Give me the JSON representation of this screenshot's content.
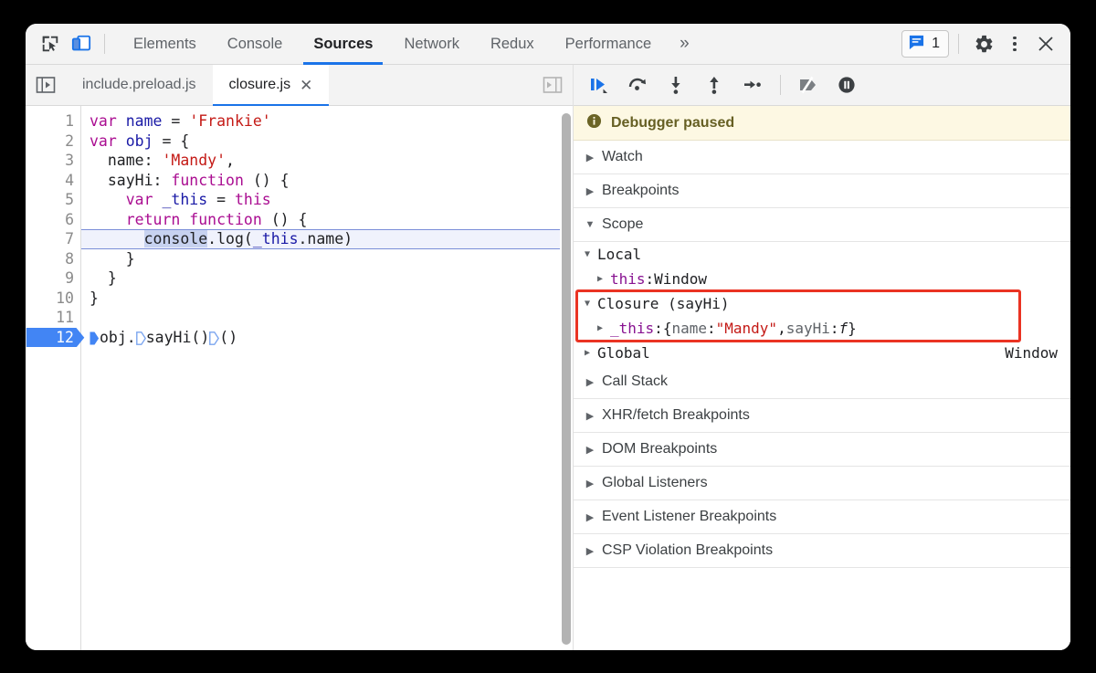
{
  "window": {
    "title": "Chrome DevTools"
  },
  "toolbar": {
    "inspect_icon": "inspect-element-icon",
    "device_icon": "device-toolbar-icon",
    "tabs": [
      {
        "label": "Elements",
        "active": false
      },
      {
        "label": "Console",
        "active": false
      },
      {
        "label": "Sources",
        "active": true
      },
      {
        "label": "Network",
        "active": false
      },
      {
        "label": "Redux",
        "active": false
      },
      {
        "label": "Performance",
        "active": false
      }
    ],
    "more_tabs": "»",
    "message_count": "1",
    "message_icon": "console-message-icon",
    "settings_icon": "gear-icon",
    "menu_icon": "kebab-menu-icon",
    "close_icon": "close-icon"
  },
  "sources": {
    "nav_left_icon": "show-navigator-icon",
    "nav_right_icon": "show-navigator-right-icon",
    "file_tabs": [
      {
        "label": "include.preload.js",
        "active": false,
        "closable": false
      },
      {
        "label": "closure.js",
        "active": true,
        "closable": true
      }
    ],
    "close_glyph": "✕",
    "code": [
      {
        "num": "1",
        "tokens": [
          {
            "t": "var ",
            "c": "k"
          },
          {
            "t": "name",
            "c": "v"
          },
          {
            "t": " = ",
            "c": "p"
          },
          {
            "t": "'Frankie'",
            "c": "s"
          }
        ]
      },
      {
        "num": "2",
        "tokens": [
          {
            "t": "var ",
            "c": "k"
          },
          {
            "t": "obj",
            "c": "v"
          },
          {
            "t": " = {",
            "c": "p"
          }
        ]
      },
      {
        "num": "3",
        "tokens": [
          {
            "t": "  name: ",
            "c": "p"
          },
          {
            "t": "'Mandy'",
            "c": "s"
          },
          {
            "t": ",",
            "c": "p"
          }
        ]
      },
      {
        "num": "4",
        "tokens": [
          {
            "t": "  sayHi: ",
            "c": "p"
          },
          {
            "t": "function",
            "c": "k"
          },
          {
            "t": " () {",
            "c": "p"
          }
        ]
      },
      {
        "num": "5",
        "tokens": [
          {
            "t": "    ",
            "c": "p"
          },
          {
            "t": "var",
            "c": "k"
          },
          {
            "t": " ",
            "c": "p"
          },
          {
            "t": "_this",
            "c": "v"
          },
          {
            "t": " = ",
            "c": "p"
          },
          {
            "t": "this",
            "c": "k"
          }
        ]
      },
      {
        "num": "6",
        "tokens": [
          {
            "t": "    ",
            "c": "p"
          },
          {
            "t": "return",
            "c": "k"
          },
          {
            "t": " ",
            "c": "p"
          },
          {
            "t": "function",
            "c": "k"
          },
          {
            "t": " () {",
            "c": "p"
          }
        ]
      },
      {
        "num": "7",
        "tokens": [
          {
            "t": "      ",
            "c": "p"
          },
          {
            "t": "console",
            "c": "p",
            "hl": true
          },
          {
            "t": ".log(",
            "c": "p"
          },
          {
            "t": "_this",
            "c": "v"
          },
          {
            "t": ".name)",
            "c": "p"
          }
        ],
        "paused": true
      },
      {
        "num": "8",
        "tokens": [
          {
            "t": "    }",
            "c": "p"
          }
        ]
      },
      {
        "num": "9",
        "tokens": [
          {
            "t": "  }",
            "c": "p"
          }
        ]
      },
      {
        "num": "10",
        "tokens": [
          {
            "t": "}",
            "c": "p"
          }
        ]
      },
      {
        "num": "11",
        "tokens": [
          {
            "t": "",
            "c": "p"
          }
        ]
      },
      {
        "num": "12",
        "tokens": [
          {
            "t": "obj.",
            "c": "p"
          },
          {
            "t": "▸",
            "c": "marker-open"
          },
          {
            "t": "sayHi()",
            "c": "p"
          },
          {
            "t": "▸",
            "c": "marker-open"
          },
          {
            "t": "()",
            "c": "p"
          }
        ],
        "breakpoint": true
      }
    ]
  },
  "debugger": {
    "controls": [
      {
        "name": "resume-script-execution",
        "icon": "resume-icon",
        "active": true
      },
      {
        "name": "step-over-next-function-call",
        "icon": "step-over-icon",
        "active": false
      },
      {
        "name": "step-into-next-function-call",
        "icon": "step-into-icon",
        "active": false
      },
      {
        "name": "step-out-of-current-function",
        "icon": "step-out-icon",
        "active": false
      },
      {
        "name": "step",
        "icon": "step-icon",
        "active": false
      },
      {
        "name": "deactivate-breakpoints",
        "icon": "deactivate-breakpoints-icon",
        "active": false
      },
      {
        "name": "pause-on-exceptions",
        "icon": "pause-on-exceptions-icon",
        "active": false
      }
    ],
    "banner": {
      "icon": "info-icon",
      "text": "Debugger paused"
    },
    "sections": [
      {
        "label": "Watch",
        "expanded": false
      },
      {
        "label": "Breakpoints",
        "expanded": false
      },
      {
        "label": "Scope",
        "expanded": true
      },
      {
        "label": "Call Stack",
        "expanded": false
      },
      {
        "label": "XHR/fetch Breakpoints",
        "expanded": false
      },
      {
        "label": "DOM Breakpoints",
        "expanded": false
      },
      {
        "label": "Global Listeners",
        "expanded": false
      },
      {
        "label": "Event Listener Breakpoints",
        "expanded": false
      },
      {
        "label": "CSP Violation Breakpoints",
        "expanded": false
      }
    ],
    "scope": {
      "rows": [
        {
          "name": "scope-local",
          "indent": 0,
          "tri": "▼",
          "parts": [
            {
              "t": "Local",
              "c": "sc-dark"
            }
          ]
        },
        {
          "name": "scope-local-this",
          "indent": 1,
          "tri": "▶",
          "parts": [
            {
              "t": "this",
              "c": "sc-purple"
            },
            {
              "t": ": ",
              "c": "sc-dark"
            },
            {
              "t": "Window",
              "c": "sc-dark"
            }
          ]
        },
        {
          "name": "scope-closure-sayhi",
          "indent": 0,
          "tri": "▼",
          "parts": [
            {
              "t": "Closure (sayHi)",
              "c": "sc-dark"
            }
          ]
        },
        {
          "name": "scope-closure-this",
          "indent": 1,
          "tri": "▶",
          "parts": [
            {
              "t": "_this",
              "c": "sc-purple"
            },
            {
              "t": ": ",
              "c": "sc-dark"
            },
            {
              "t": "{",
              "c": "sc-dark"
            },
            {
              "t": "name",
              "c": "sc-gray"
            },
            {
              "t": ": ",
              "c": "sc-dark"
            },
            {
              "t": "\"Mandy\"",
              "c": "sc-red"
            },
            {
              "t": ", ",
              "c": "sc-dark"
            },
            {
              "t": "sayHi",
              "c": "sc-gray"
            },
            {
              "t": ": ",
              "c": "sc-dark"
            },
            {
              "t": "f",
              "c": "sc-italic"
            },
            {
              "t": "}",
              "c": "sc-dark"
            }
          ]
        },
        {
          "name": "scope-global",
          "indent": 0,
          "tri": "▶",
          "parts": [
            {
              "t": "Global",
              "c": "sc-dark"
            }
          ],
          "right": "Window"
        }
      ],
      "highlight_color": "#ea3323"
    },
    "colors": {
      "accent": "#1a73e8",
      "banner_bg": "#fdf8e3",
      "banner_text": "#665f23",
      "highlight_box": "#ea3323"
    }
  }
}
